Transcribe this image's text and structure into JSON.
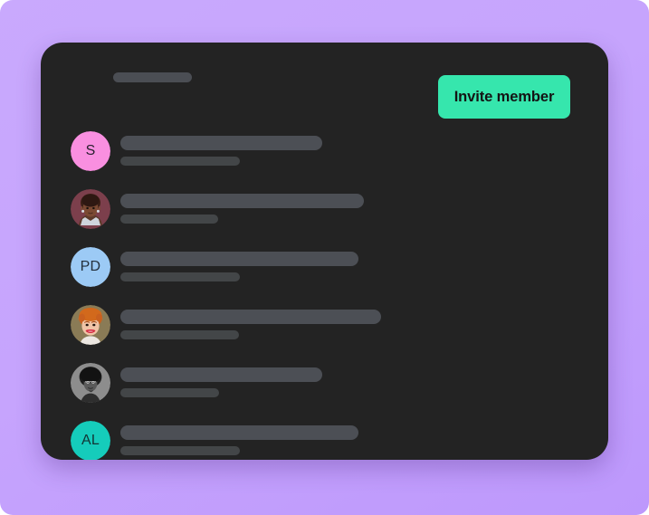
{
  "page": {
    "background_gradient_from": "#c9a9fd",
    "background_gradient_to": "#bd98fc"
  },
  "card": {
    "background": "#232323",
    "header": {
      "title_placeholder_width": 87,
      "invite_button": {
        "label": "Invite member",
        "background": "#36e6ad",
        "text_color": "#141414"
      }
    }
  },
  "members": [
    {
      "avatar": {
        "type": "initials",
        "initials": "S",
        "background": "#f98fe0",
        "text_color": "#2a2030",
        "name": "avatar-initials-s"
      },
      "name_placeholder_width": 223,
      "meta_placeholder_width": 132
    },
    {
      "avatar": {
        "type": "photo",
        "description": "portrait-woman-short-hair",
        "background": "#7c3f4c",
        "name": "avatar-photo-woman-short-hair"
      },
      "name_placeholder_width": 269,
      "meta_placeholder_width": 108
    },
    {
      "avatar": {
        "type": "initials",
        "initials": "PD",
        "background": "#9ccaf5",
        "text_color": "#24303c",
        "name": "avatar-initials-pd"
      },
      "name_placeholder_width": 263,
      "meta_placeholder_width": 132
    },
    {
      "avatar": {
        "type": "photo",
        "description": "portrait-woman-red-hair",
        "background": "#8a7b56",
        "name": "avatar-photo-woman-red-hair"
      },
      "name_placeholder_width": 288,
      "meta_placeholder_width": 131
    },
    {
      "avatar": {
        "type": "photo",
        "description": "portrait-person-afro-monochrome",
        "background": "#6d6d6d",
        "name": "avatar-photo-person-afro"
      },
      "name_placeholder_width": 223,
      "meta_placeholder_width": 109
    },
    {
      "avatar": {
        "type": "initials",
        "initials": "AL",
        "background": "#15ccbb",
        "text_color": "#123434",
        "name": "avatar-initials-al"
      },
      "name_placeholder_width": 263,
      "meta_placeholder_width": 132
    }
  ]
}
